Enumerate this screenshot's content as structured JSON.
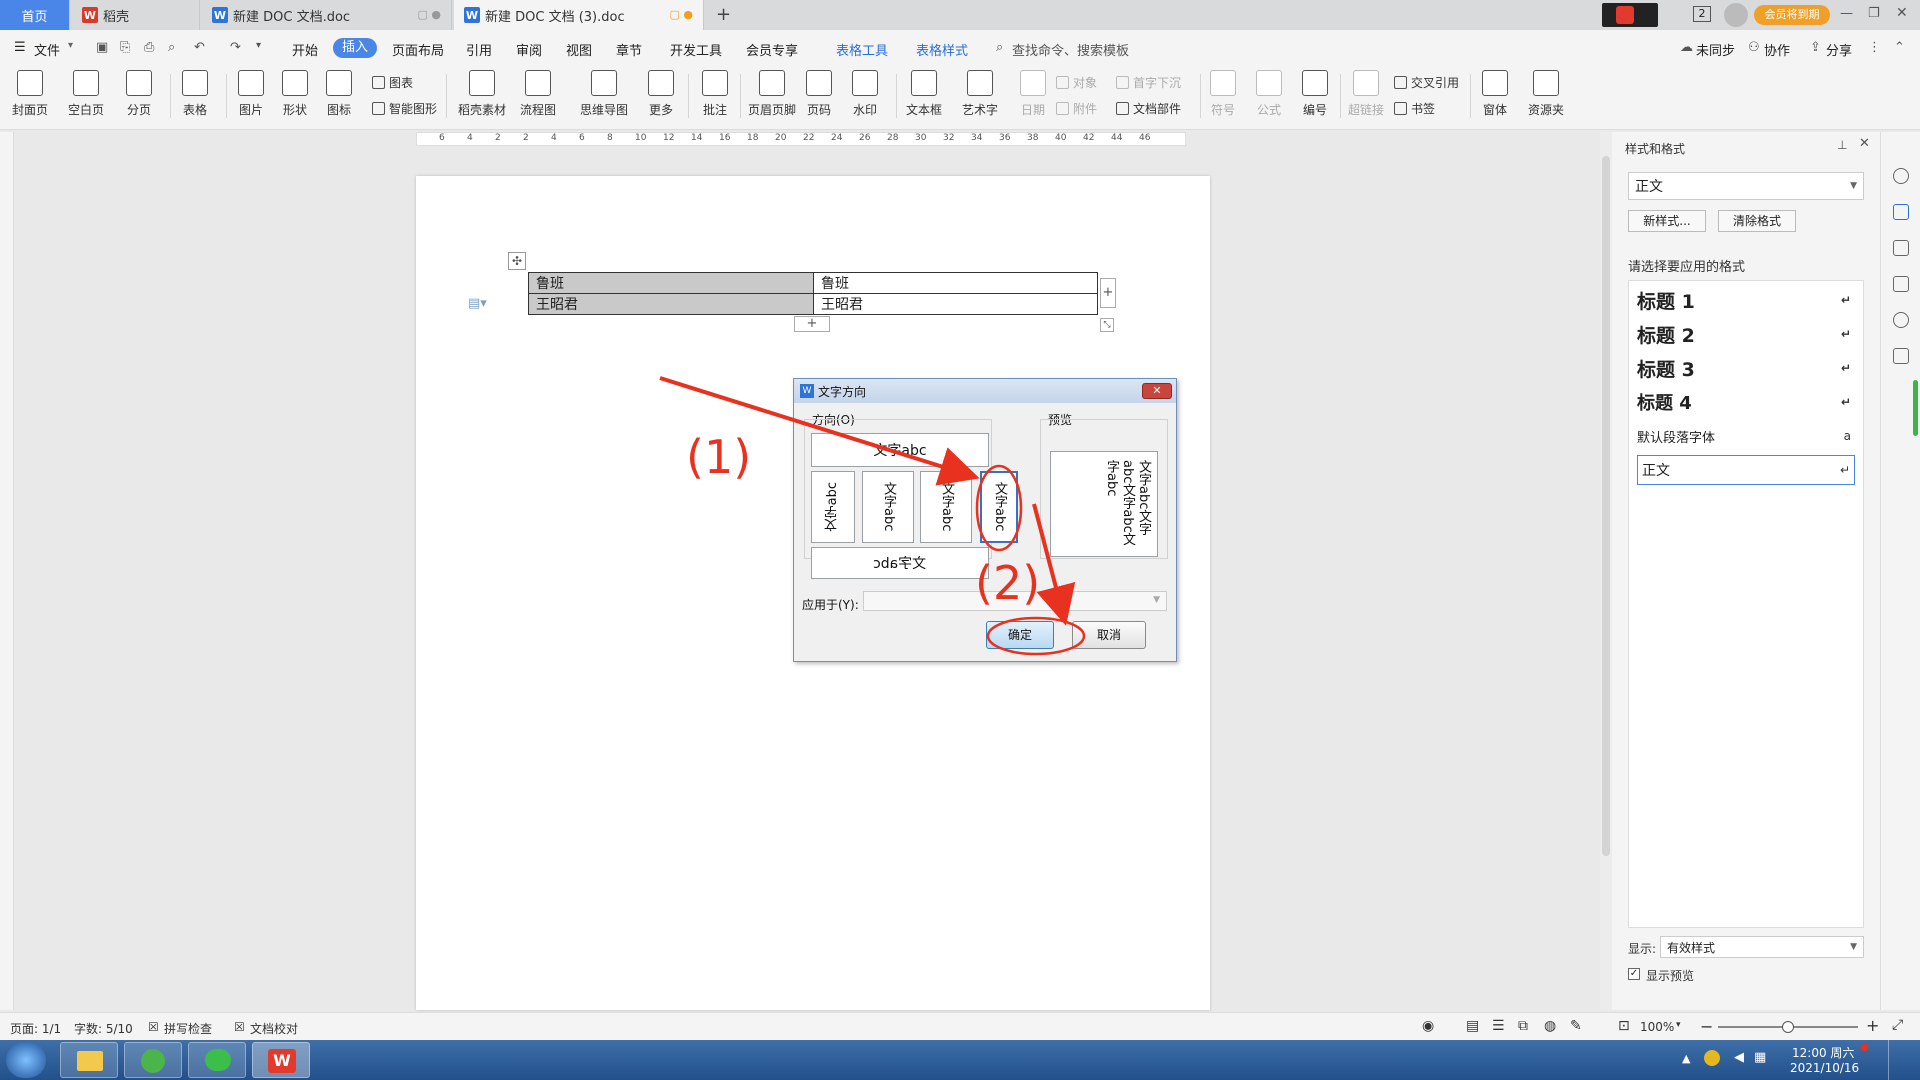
{
  "tabs": {
    "home": "首页",
    "wps_tab": "稻壳",
    "doc1": "新建 DOC 文档.doc",
    "doc2": "新建 DOC 文档 (3).doc"
  },
  "title_right": {
    "page_num": "2",
    "vip_badge": "会员将到期"
  },
  "menu": {
    "file": "文件",
    "items": [
      "开始",
      "插入",
      "页面布局",
      "引用",
      "审阅",
      "视图",
      "章节",
      "开发工具",
      "会员专享"
    ],
    "table_tools": "表格工具",
    "table_style": "表格样式",
    "search": "查找命令、搜索模板",
    "not_synced": "未同步",
    "collab": "协作",
    "share": "分享"
  },
  "ribbon": {
    "cover": "封面页",
    "blank": "空白页",
    "pagebreak": "分页",
    "table": "表格",
    "picture": "图片",
    "shape": "形状",
    "icon": "图标",
    "chart": "图表",
    "smartart": "智能图形",
    "docer": "稻壳素材",
    "flow": "流程图",
    "mind": "思维导图",
    "more": "更多",
    "comment": "批注",
    "header": "页眉页脚",
    "pagenum": "页码",
    "watermark": "水印",
    "textbox": "文本框",
    "wordart": "艺术字",
    "date": "日期",
    "object": "对象",
    "attach": "附件",
    "dropcap": "首字下沉",
    "docpart": "文档部件",
    "symbol": "符号",
    "formula": "公式",
    "numbering": "编号",
    "hyperlink": "超链接",
    "crossref": "交叉引用",
    "bookmark": "书签",
    "window": "窗体",
    "resource": "资源夹"
  },
  "ruler_ticks": [
    "6",
    "4",
    "2",
    "2",
    "4",
    "6",
    "8",
    "10",
    "12",
    "14",
    "16",
    "18",
    "20",
    "22",
    "24",
    "26",
    "28",
    "30",
    "32",
    "34",
    "36",
    "38",
    "40",
    "42",
    "44",
    "46"
  ],
  "table": {
    "rows": [
      [
        "鲁班",
        "鲁班"
      ],
      [
        "王昭君",
        "王昭君"
      ]
    ]
  },
  "dialog": {
    "title": "文字方向",
    "direction_label": "方向(O)",
    "preview_label": "预览",
    "opt_horizontal": "文字abc",
    "opt_v1": "文字abc",
    "opt_v2": "文字abc",
    "opt_v3": "文字abc",
    "opt_v4": "文字abc",
    "opt_rotated": "文字abc",
    "preview_text": "文字abc文字abc文字abc文字abc",
    "apply_label": "应用于(Y):",
    "ok": "确定",
    "cancel": "取消"
  },
  "annotations": {
    "step1": "(1)",
    "step2": "(2)"
  },
  "panel": {
    "title": "样式和格式",
    "current_style": "正文",
    "new_style": "新样式...",
    "clear_format": "清除格式",
    "prompt": "请选择要应用的格式",
    "styles": [
      "标题  1",
      "标题  2",
      "标题  3",
      "标题  4",
      "默认段落字体",
      "正文"
    ],
    "show_label": "显示:",
    "show_value": "有效样式",
    "preview_check": "显示预览"
  },
  "status": {
    "page": "页面: 1/1",
    "words": "字数: 5/10",
    "spell": "拼写检查",
    "proof": "文档校对",
    "zoom": "100%"
  },
  "clock": {
    "time": "12:00 周六",
    "date": "2021/10/16"
  },
  "colors": {
    "accent": "#4a86e8",
    "annotation": "#e8321f"
  }
}
